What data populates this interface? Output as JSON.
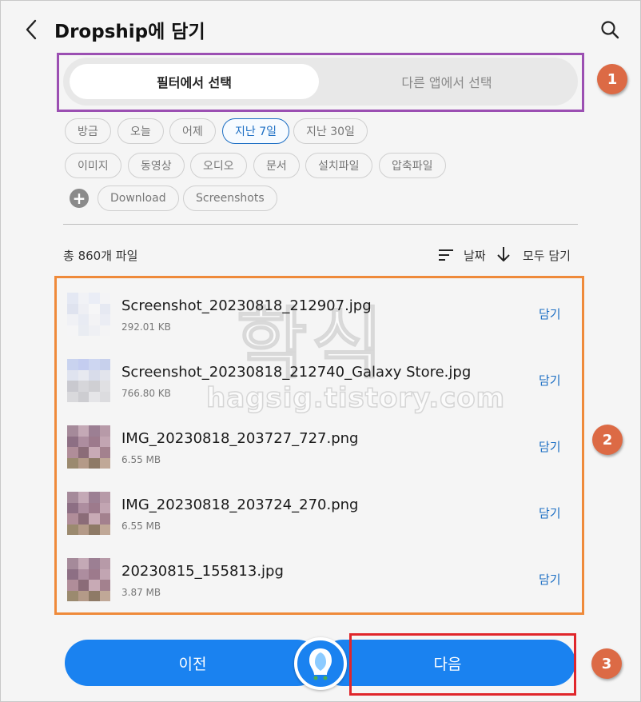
{
  "header": {
    "title": "Dropship에 담기"
  },
  "segment": {
    "active": "필터에서 선택",
    "inactive": "다른 앱에서 선택"
  },
  "badges": [
    "1",
    "2",
    "3"
  ],
  "time_filters": [
    "방금",
    "오늘",
    "어제",
    "지난 7일",
    "지난 30일"
  ],
  "selected_time_filter": "지난 7일",
  "type_filters": [
    "이미지",
    "동영상",
    "오디오",
    "문서",
    "설치파일",
    "압축파일"
  ],
  "folder_filters": [
    "Download",
    "Screenshots"
  ],
  "summary": {
    "count_text": "총 860개 파일",
    "sort_label": "날짜",
    "add_all": "모두 담기"
  },
  "files": [
    {
      "name": "Screenshot_20230818_212907.jpg",
      "size": "292.01 KB",
      "action": "담기",
      "thumb": "light"
    },
    {
      "name": "Screenshot_20230818_212740_Galaxy Store.jpg",
      "size": "766.80 KB",
      "action": "담기",
      "thumb": "blue"
    },
    {
      "name": "IMG_20230818_203727_727.png",
      "size": "6.55 MB",
      "action": "담기",
      "thumb": "photo"
    },
    {
      "name": "IMG_20230818_203724_270.png",
      "size": "6.55 MB",
      "action": "담기",
      "thumb": "photo"
    },
    {
      "name": "20230815_155813.jpg",
      "size": "3.87 MB",
      "action": "담기",
      "thumb": "photo"
    }
  ],
  "watermark": {
    "big": "학식",
    "small": "hagsig.tistory.com"
  },
  "buttons": {
    "prev": "이전",
    "next": "다음"
  },
  "colors": {
    "accent": "#1a82f0",
    "badge": "#dc6a45",
    "segment_outline": "#9b4fb2",
    "list_outline": "#ef8a3a",
    "next_outline": "#e0262b"
  },
  "icons": {
    "back": "back-arrow-icon",
    "search": "search-icon",
    "sort": "sort-lines-icon",
    "sort_direction": "arrow-down-icon",
    "add": "plus-icon",
    "logo": "dropship-logo-icon"
  }
}
